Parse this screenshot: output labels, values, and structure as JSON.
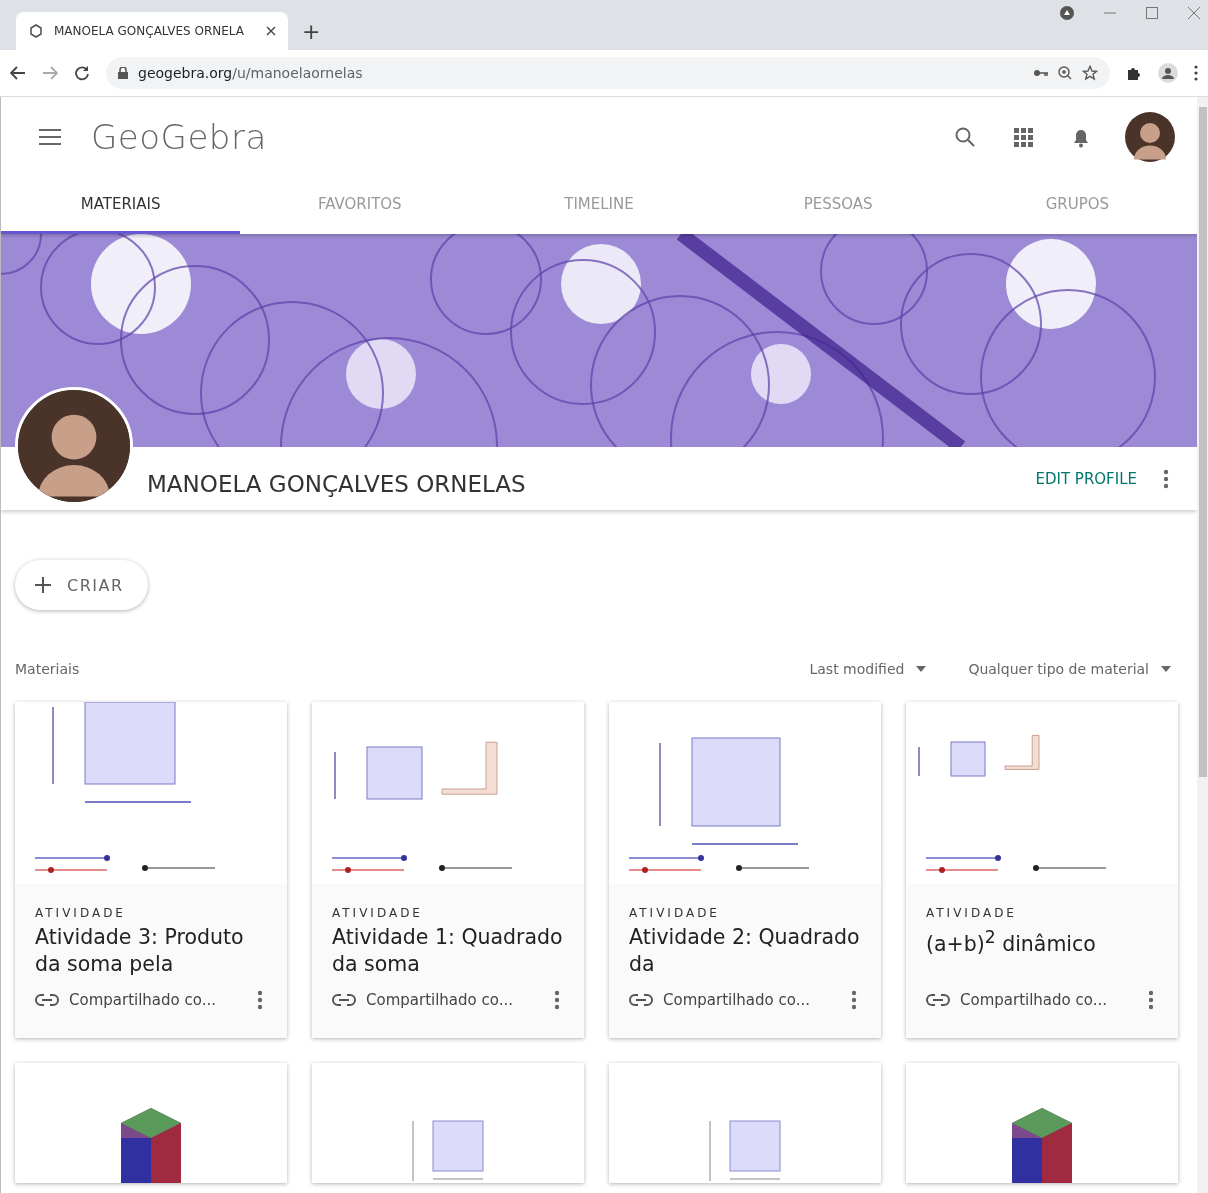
{
  "browser": {
    "tab_title": "MANOELA GONÇALVES ORNELA",
    "new_tab": "+",
    "url_host": "geogebra.org",
    "url_path": "/u/manoelaornelas"
  },
  "header": {
    "logo": "GeoGebra"
  },
  "tabs": [
    {
      "label": "MATERIAIS",
      "selected": true
    },
    {
      "label": "FAVORITOS",
      "selected": false
    },
    {
      "label": "TIMELINE",
      "selected": false
    },
    {
      "label": "PESSOAS",
      "selected": false
    },
    {
      "label": "GRUPOS",
      "selected": false
    }
  ],
  "profile": {
    "name": "MANOELA GONÇALVES ORNELAS",
    "edit_button": "EDIT PROFILE"
  },
  "create_button": "CRIAR",
  "materials": {
    "heading": "Materiais",
    "sort": "Last modified",
    "filter": "Qualquer tipo de material"
  },
  "cards": [
    {
      "type": "ATIVIDADE",
      "title": "Atividade 3: Produto da soma pela",
      "sharing": "Compartilhado co..."
    },
    {
      "type": "ATIVIDADE",
      "title": "Atividade 1: Quadrado da soma",
      "sharing": "Compartilhado co..."
    },
    {
      "type": "ATIVIDADE",
      "title": "Atividade 2: Quadrado da",
      "sharing": "Compartilhado co..."
    },
    {
      "type": "ATIVIDADE",
      "title": "(a+b)$^{2}$ dinâmico",
      "sharing": "Compartilhado co..."
    }
  ]
}
